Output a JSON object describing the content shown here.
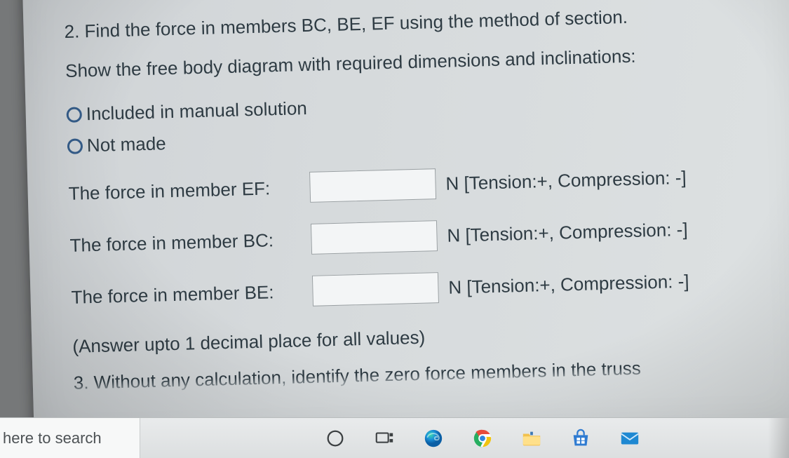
{
  "question": {
    "title": "2. Find the force in members BC, BE, EF using the method of section.",
    "subtitle": "Show the free body diagram with required dimensions and inclinations:",
    "radios": [
      {
        "label": "Included in manual solution"
      },
      {
        "label": "Not made"
      }
    ],
    "fields": [
      {
        "label": "The force in member EF:",
        "value": "",
        "suffix": "N [Tension:+, Compression: -]"
      },
      {
        "label": "The force in member BC:",
        "value": "",
        "suffix": "N [Tension:+, Compression: -]"
      },
      {
        "label": "The force in member BE:",
        "value": "",
        "suffix": "N [Tension:+, Compression: -]"
      }
    ],
    "hint": "(Answer upto 1 decimal place for all values)",
    "next_partial": "3. Without any calculation, identify the zero force members in the truss"
  },
  "taskbar": {
    "search_text": "here to search"
  }
}
